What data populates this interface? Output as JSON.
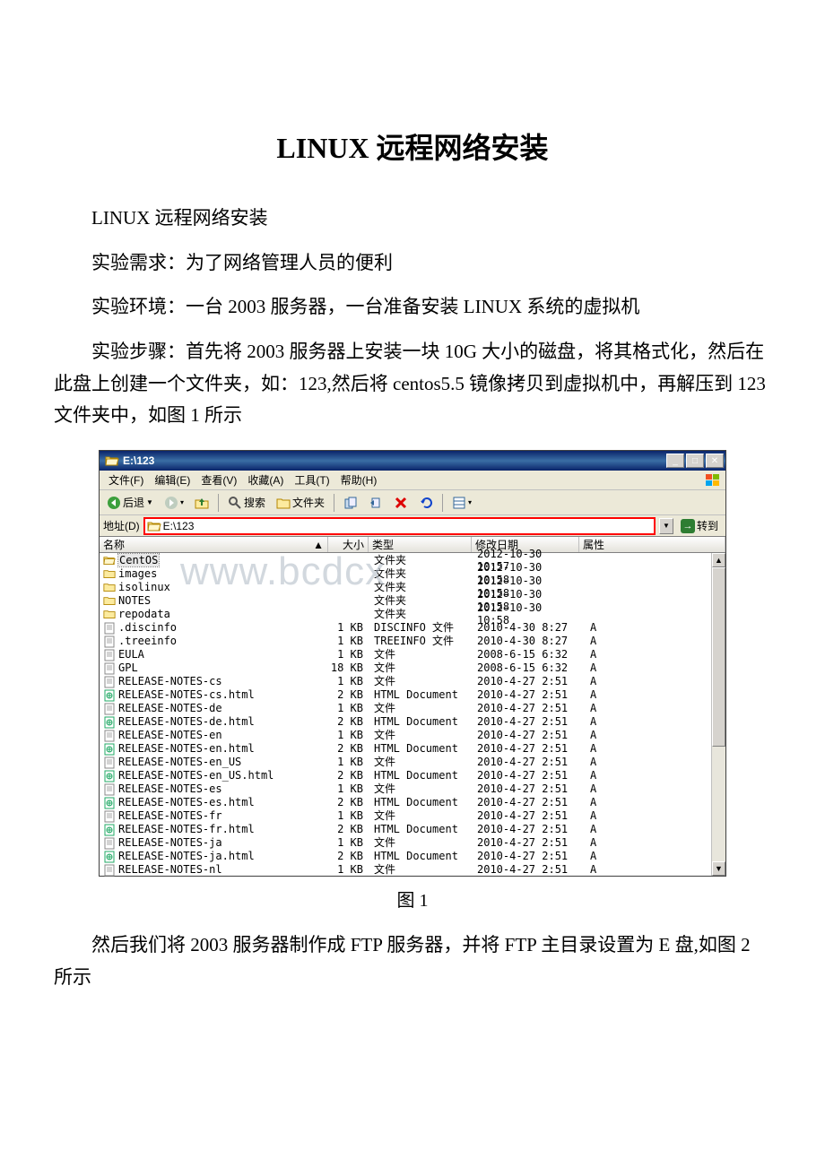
{
  "doc": {
    "title": "LINUX 远程网络安装",
    "p1": "LINUX 远程网络安装",
    "p2": "实验需求：为了网络管理人员的便利",
    "p3": "实验环境：一台 2003 服务器，一台准备安装 LINUX 系统的虚拟机",
    "p4": "实验步骤：首先将 2003 服务器上安装一块 10G 大小的磁盘，将其格式化，然后在此盘上创建一个文件夹，如：123,然后将 centos5.5 镜像拷贝到虚拟机中，再解压到 123 文件夹中，如图 1 所示",
    "fig1": "图 1",
    "p5": "然后我们将 2003 服务器制作成 FTP 服务器，并将 FTP 主目录设置为 E 盘,如图 2 所示"
  },
  "watermark": "www.bcdcx",
  "explorer": {
    "title": "E:\\123",
    "menus": [
      "文件(F)",
      "编辑(E)",
      "查看(V)",
      "收藏(A)",
      "工具(T)",
      "帮助(H)"
    ],
    "toolbar": {
      "back": "后退",
      "search": "搜索",
      "folders": "文件夹"
    },
    "address": {
      "label": "地址(D)",
      "path": "E:\\123",
      "go": "转到"
    },
    "columns": {
      "name": "名称",
      "size": "大小",
      "type": "类型",
      "date": "修改日期",
      "attr": "属性"
    },
    "files": [
      {
        "icon": "folder-open",
        "name": "CentOS",
        "size": "",
        "type": "文件夹",
        "date": "2012-10-30 10:57",
        "attr": "",
        "sel": true
      },
      {
        "icon": "folder",
        "name": "images",
        "size": "",
        "type": "文件夹",
        "date": "2012-10-30 10:58",
        "attr": ""
      },
      {
        "icon": "folder",
        "name": "isolinux",
        "size": "",
        "type": "文件夹",
        "date": "2012-10-30 10:58",
        "attr": ""
      },
      {
        "icon": "folder",
        "name": "NOTES",
        "size": "",
        "type": "文件夹",
        "date": "2012-10-30 10:58",
        "attr": ""
      },
      {
        "icon": "folder",
        "name": "repodata",
        "size": "",
        "type": "文件夹",
        "date": "2012-10-30 10:58",
        "attr": ""
      },
      {
        "icon": "file",
        "name": ".discinfo",
        "size": "1 KB",
        "type": "DISCINFO 文件",
        "date": "2010-4-30 8:27",
        "attr": "A"
      },
      {
        "icon": "file",
        "name": ".treeinfo",
        "size": "1 KB",
        "type": "TREEINFO 文件",
        "date": "2010-4-30 8:27",
        "attr": "A"
      },
      {
        "icon": "file",
        "name": "EULA",
        "size": "1 KB",
        "type": "文件",
        "date": "2008-6-15 6:32",
        "attr": "A"
      },
      {
        "icon": "file",
        "name": "GPL",
        "size": "18 KB",
        "type": "文件",
        "date": "2008-6-15 6:32",
        "attr": "A"
      },
      {
        "icon": "file",
        "name": "RELEASE-NOTES-cs",
        "size": "1 KB",
        "type": "文件",
        "date": "2010-4-27 2:51",
        "attr": "A"
      },
      {
        "icon": "html",
        "name": "RELEASE-NOTES-cs.html",
        "size": "2 KB",
        "type": "HTML Document",
        "date": "2010-4-27 2:51",
        "attr": "A"
      },
      {
        "icon": "file",
        "name": "RELEASE-NOTES-de",
        "size": "1 KB",
        "type": "文件",
        "date": "2010-4-27 2:51",
        "attr": "A"
      },
      {
        "icon": "html",
        "name": "RELEASE-NOTES-de.html",
        "size": "2 KB",
        "type": "HTML Document",
        "date": "2010-4-27 2:51",
        "attr": "A"
      },
      {
        "icon": "file",
        "name": "RELEASE-NOTES-en",
        "size": "1 KB",
        "type": "文件",
        "date": "2010-4-27 2:51",
        "attr": "A"
      },
      {
        "icon": "html",
        "name": "RELEASE-NOTES-en.html",
        "size": "2 KB",
        "type": "HTML Document",
        "date": "2010-4-27 2:51",
        "attr": "A"
      },
      {
        "icon": "file",
        "name": "RELEASE-NOTES-en_US",
        "size": "1 KB",
        "type": "文件",
        "date": "2010-4-27 2:51",
        "attr": "A"
      },
      {
        "icon": "html",
        "name": "RELEASE-NOTES-en_US.html",
        "size": "2 KB",
        "type": "HTML Document",
        "date": "2010-4-27 2:51",
        "attr": "A"
      },
      {
        "icon": "file",
        "name": "RELEASE-NOTES-es",
        "size": "1 KB",
        "type": "文件",
        "date": "2010-4-27 2:51",
        "attr": "A"
      },
      {
        "icon": "html",
        "name": "RELEASE-NOTES-es.html",
        "size": "2 KB",
        "type": "HTML Document",
        "date": "2010-4-27 2:51",
        "attr": "A"
      },
      {
        "icon": "file",
        "name": "RELEASE-NOTES-fr",
        "size": "1 KB",
        "type": "文件",
        "date": "2010-4-27 2:51",
        "attr": "A"
      },
      {
        "icon": "html",
        "name": "RELEASE-NOTES-fr.html",
        "size": "2 KB",
        "type": "HTML Document",
        "date": "2010-4-27 2:51",
        "attr": "A"
      },
      {
        "icon": "file",
        "name": "RELEASE-NOTES-ja",
        "size": "1 KB",
        "type": "文件",
        "date": "2010-4-27 2:51",
        "attr": "A"
      },
      {
        "icon": "html",
        "name": "RELEASE-NOTES-ja.html",
        "size": "2 KB",
        "type": "HTML Document",
        "date": "2010-4-27 2:51",
        "attr": "A"
      },
      {
        "icon": "file",
        "name": "RELEASE-NOTES-nl",
        "size": "1 KB",
        "type": "文件",
        "date": "2010-4-27 2:51",
        "attr": "A"
      }
    ]
  }
}
